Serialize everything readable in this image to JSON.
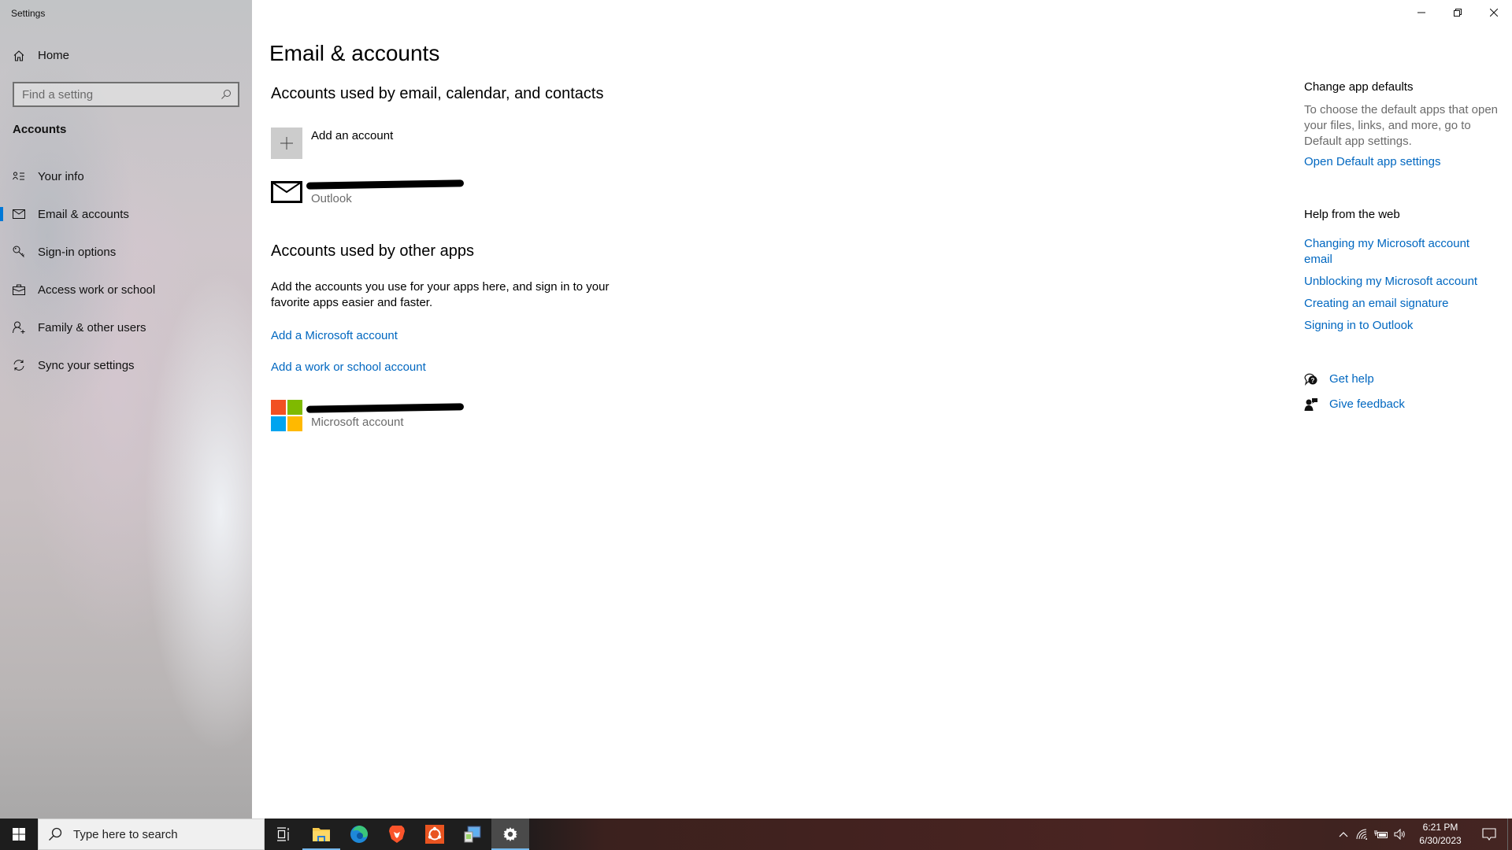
{
  "window": {
    "title": "Settings",
    "controls": {
      "minimize": "minimize",
      "restore": "restore",
      "close": "close"
    }
  },
  "sidebar": {
    "home_label": "Home",
    "search_placeholder": "Find a setting",
    "search_value": "",
    "section_title": "Accounts",
    "items": [
      {
        "label": "Your info",
        "icon": "contact-info-icon",
        "active": false
      },
      {
        "label": "Email & accounts",
        "icon": "mail-icon",
        "active": true
      },
      {
        "label": "Sign-in options",
        "icon": "key-icon",
        "active": false
      },
      {
        "label": "Access work or school",
        "icon": "briefcase-icon",
        "active": false
      },
      {
        "label": "Family & other users",
        "icon": "add-person-icon",
        "active": false
      },
      {
        "label": "Sync your settings",
        "icon": "sync-icon",
        "active": false
      }
    ],
    "accent_color": "#0078d7"
  },
  "main": {
    "page_title": "Email & accounts",
    "email_section": {
      "heading": "Accounts used by email, calendar, and contacts",
      "add_account_label": "Add an account",
      "accounts": [
        {
          "name": "[redacted]",
          "type": "Outlook"
        }
      ]
    },
    "other_apps_section": {
      "heading": "Accounts used by other apps",
      "description": "Add the accounts you use for your apps here, and sign in to your favorite apps easier and faster.",
      "add_microsoft_link": "Add a Microsoft account",
      "add_work_link": "Add a work or school account",
      "accounts": [
        {
          "name": "[redacted]",
          "type": "Microsoft account"
        }
      ]
    }
  },
  "right_panel": {
    "change_defaults": {
      "heading": "Change app defaults",
      "description": "To choose the default apps that open your files, links, and more, go to Default app settings.",
      "link": "Open Default app settings"
    },
    "help_from_web": {
      "heading": "Help from the web",
      "links": [
        "Changing my Microsoft account email",
        "Unblocking my Microsoft account",
        "Creating an email signature",
        "Signing in to Outlook"
      ]
    },
    "get_help": "Get help",
    "give_feedback": "Give feedback",
    "link_color": "#0067c0"
  },
  "taskbar": {
    "search_placeholder": "Type here to search",
    "apps": [
      {
        "name": "task-view",
        "running": false
      },
      {
        "name": "file-explorer",
        "running": true
      },
      {
        "name": "edge",
        "running": false
      },
      {
        "name": "brave",
        "running": false
      },
      {
        "name": "ubuntu",
        "running": false
      },
      {
        "name": "control-panel",
        "running": false
      },
      {
        "name": "settings",
        "running": true,
        "active": true
      }
    ],
    "time": "6:21 PM",
    "date": "6/30/2023"
  }
}
